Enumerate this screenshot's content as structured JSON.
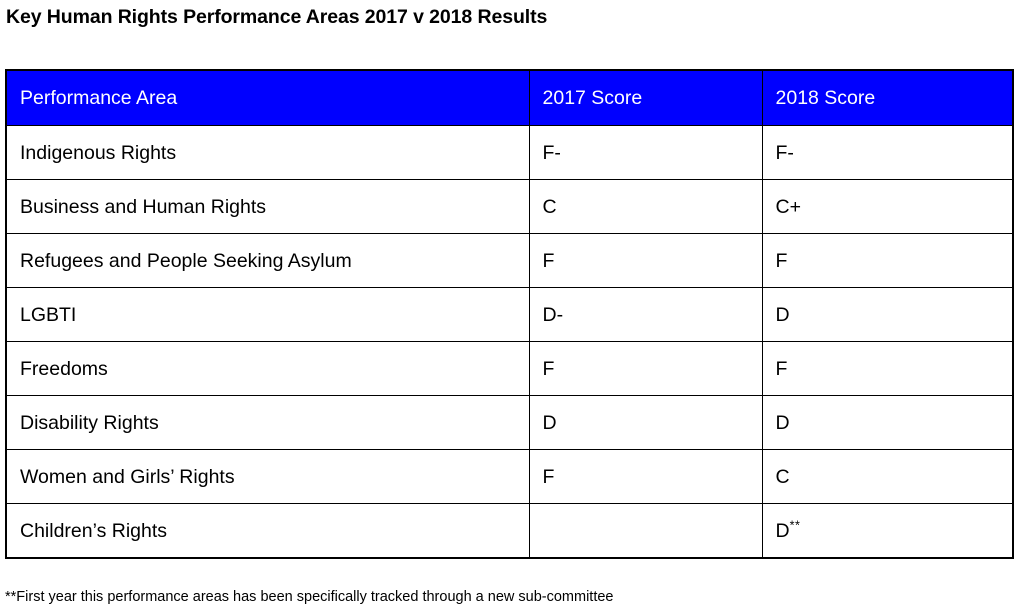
{
  "page": {
    "title": "Key Human Rights Performance Areas 2017 v 2018 Results",
    "background_color": "#ffffff",
    "text_color": "#000000"
  },
  "table": {
    "header_background_color": "#0000ff",
    "header_text_color": "#ffffff",
    "border_color": "#000000",
    "columns": [
      {
        "key": "area",
        "label": "Performance Area"
      },
      {
        "key": "score_2017",
        "label": "2017 Score"
      },
      {
        "key": "score_2018",
        "label": "2018 Score"
      }
    ],
    "rows": [
      {
        "area": "Indigenous Rights",
        "score_2017": "F-",
        "score_2018": "F-",
        "score_2018_note": ""
      },
      {
        "area": "Business and Human Rights",
        "score_2017": "C",
        "score_2018": "C+",
        "score_2018_note": ""
      },
      {
        "area": "Refugees and People Seeking Asylum",
        "score_2017": "F",
        "score_2018": "F",
        "score_2018_note": ""
      },
      {
        "area": "LGBTI",
        "score_2017": "D-",
        "score_2018": "D",
        "score_2018_note": ""
      },
      {
        "area": "Freedoms",
        "score_2017": "F",
        "score_2018": "F",
        "score_2018_note": ""
      },
      {
        "area": "Disability Rights",
        "score_2017": "D",
        "score_2018": "D",
        "score_2018_note": ""
      },
      {
        "area": "Women and Girls’ Rights",
        "score_2017": "F",
        "score_2018": "C",
        "score_2018_note": ""
      },
      {
        "area": "Children’s Rights",
        "score_2017": "",
        "score_2018": "D",
        "score_2018_note": "**"
      }
    ]
  },
  "footnote": {
    "text": "**First year this performance areas has been specifically tracked through a new sub-committee"
  }
}
